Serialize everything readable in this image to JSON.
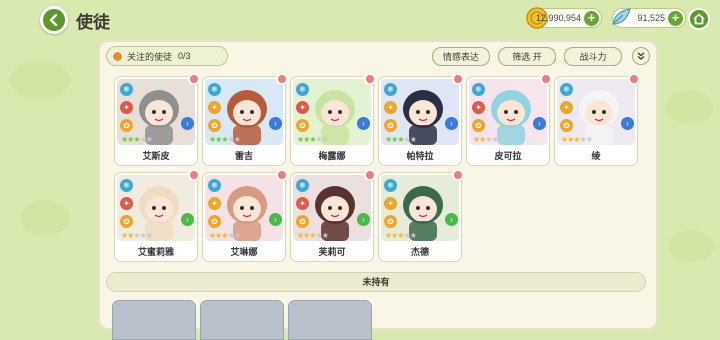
{
  "header": {
    "title": "使徒",
    "currency_gold": "12,990,954",
    "currency_gem": "91,525"
  },
  "filters": {
    "favorites_label": "关注的使徒",
    "favorites_count": "0/3",
    "emotion_button": "情感表达",
    "filter_button": "筛选 开",
    "sort_button": "战斗力"
  },
  "characters": [
    {
      "name": "艾斯皮",
      "stars_gold": 0,
      "stars_green": 3
    },
    {
      "name": "雷吉",
      "stars_gold": 0,
      "stars_green": 3
    },
    {
      "name": "梅露娜",
      "stars_gold": 0,
      "stars_green": 3
    },
    {
      "name": "帕特拉",
      "stars_gold": 0,
      "stars_green": 3
    },
    {
      "name": "皮可拉",
      "stars_gold": 2,
      "stars_green": 0
    },
    {
      "name": "绫",
      "stars_gold": 3,
      "stars_green": 0
    },
    {
      "name": "艾蜜莉雅",
      "stars_gold": 2,
      "stars_green": 0
    },
    {
      "name": "艾琳娜",
      "stars_gold": 3,
      "stars_green": 0
    },
    {
      "name": "芙莉可",
      "stars_gold": 3,
      "stars_green": 0
    },
    {
      "name": "杰德",
      "stars_gold": 3,
      "stars_green": 0
    }
  ],
  "unowned_section": {
    "label": "未持有"
  },
  "colors": {
    "accent_green": "#5a9a2a",
    "background": "#d9eab0",
    "panel": "#f9f6e6",
    "favorite_pink": "#f37a7a"
  }
}
